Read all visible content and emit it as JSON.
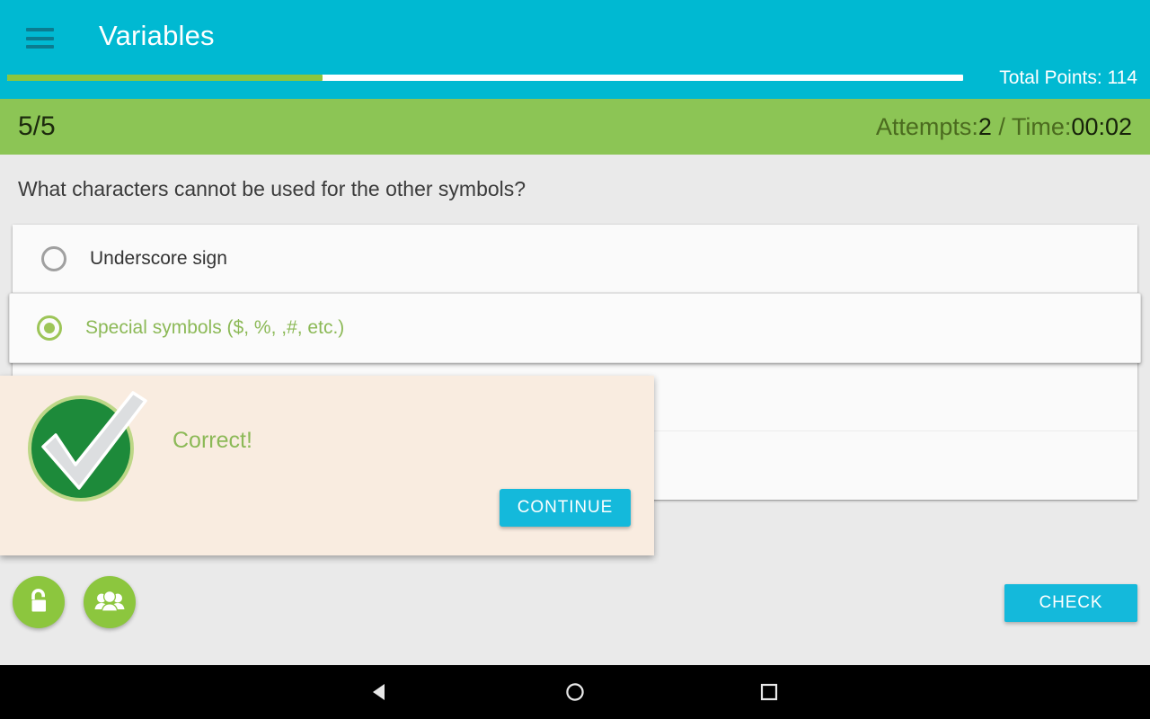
{
  "appbar": {
    "menu_icon": "hamburger-menu-icon",
    "title": "Variables",
    "total_points_label": "Total Points: 114",
    "progress_percent": 33,
    "bg_color": "#00b9d2",
    "progress_fill_color": "#8cc63e"
  },
  "statusbar": {
    "progress_count": "5/5",
    "attempts_label": "Attempts:",
    "attempts_value": "2",
    "separator": " / ",
    "time_label": "Time:",
    "time_value": "00:02",
    "bg_color": "#8cc555"
  },
  "quiz": {
    "question": "What characters cannot be used for the other symbols?",
    "options": [
      {
        "label": "Underscore sign",
        "selected": false
      },
      {
        "label": "Special symbols ($, %, ,#, etc.)",
        "selected": true
      },
      {
        "label": "",
        "selected": false
      },
      {
        "label": "",
        "selected": false
      }
    ]
  },
  "actions": {
    "lock_icon": "open-lock-icon",
    "group_icon": "people-group-icon",
    "check_label": "CHECK",
    "accent_color": "#14b9db",
    "fab_color": "#8cc63e"
  },
  "dialog": {
    "icon": "green-check-circle-icon",
    "message": "Correct!",
    "continue_label": "CONTINUE",
    "bg_color": "#f9ece0",
    "message_color": "#8cb957"
  },
  "navbar": {
    "back_icon": "back-triangle-icon",
    "home_icon": "home-circle-icon",
    "recents_icon": "recents-square-icon"
  }
}
